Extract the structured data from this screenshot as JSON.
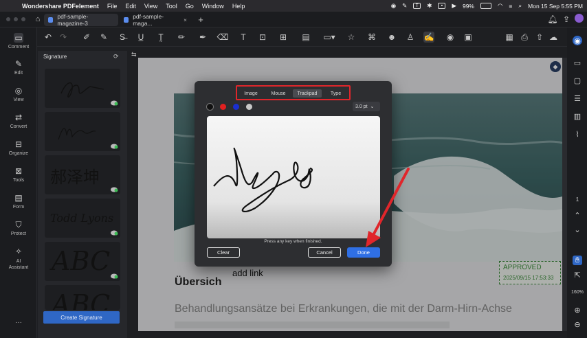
{
  "menubar": {
    "app_name": "Wondershare PDFelement",
    "items": [
      "File",
      "Edit",
      "View",
      "Tool",
      "Go",
      "Window",
      "Help"
    ],
    "battery": "99%",
    "datetime": "Mon 15 Sep  5:55 PM"
  },
  "tabs": [
    {
      "label": "pdf-sample-magazine-3"
    },
    {
      "label": "pdf-sample-maga..."
    }
  ],
  "leftnav": [
    {
      "label": "Comment"
    },
    {
      "label": "Edit"
    },
    {
      "label": "View"
    },
    {
      "label": "Convert"
    },
    {
      "label": "Organize"
    },
    {
      "label": "Tools"
    },
    {
      "label": "Form"
    },
    {
      "label": "Protect"
    },
    {
      "label": "AI\nAssistant"
    }
  ],
  "signature_panel": {
    "title": "Signature",
    "create_label": "Create Signature",
    "sample_texts": [
      "郝泽坤",
      "Todd Lyons",
      "ABC",
      "ABC"
    ]
  },
  "dialog": {
    "tabs": [
      "Image",
      "Mouse",
      "Trackpad",
      "Type"
    ],
    "selected_tab": "Trackpad",
    "colors": [
      "#111111",
      "#e02020",
      "#1a2fd0",
      "#c8c8c8"
    ],
    "pt_value": "3.0 pt",
    "hint": "Press any key when finished.",
    "clear_label": "Clear",
    "cancel_label": "Cancel",
    "done_label": "Done"
  },
  "document": {
    "heading": "Übersich",
    "add_link": "add link",
    "body": "Behandlungsansätze bei Erkrankungen, die mit der Darm-Hirn-Achse",
    "stamp_title": "APPROVED",
    "stamp_date": "2025/09/15 17:53:33"
  },
  "rightbar": {
    "page": "1",
    "zoom": "160%"
  },
  "accent": "#2f67c5",
  "annotation_color": "#e0262b"
}
